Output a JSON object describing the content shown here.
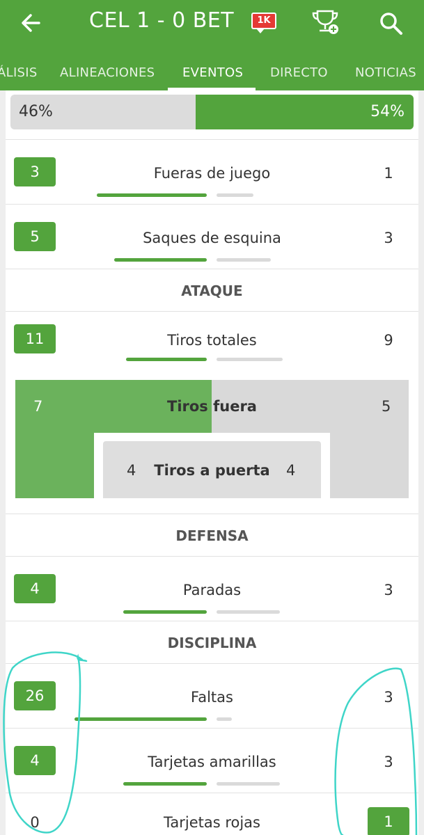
{
  "header": {
    "title": "CEL 1 - 0 BET",
    "badge": "1K"
  },
  "tabs": [
    {
      "label": "ÁLISIS"
    },
    {
      "label": "ALINEACIONES"
    },
    {
      "label": "EVENTOS"
    },
    {
      "label": "DIRECTO"
    },
    {
      "label": "NOTICIAS"
    }
  ],
  "active_tab": "EVENTOS",
  "possession": {
    "home": "46%",
    "away": "54%",
    "home_value": 46,
    "away_value": 54
  },
  "stats": {
    "offsides": {
      "home": "3",
      "label": "Fueras de juego",
      "away": "1"
    },
    "corners": {
      "home": "5",
      "label": "Saques de esquina",
      "away": "3"
    },
    "total_shots": {
      "home": "11",
      "label": "Tiros totales",
      "away": "9"
    },
    "shots_off": {
      "home": "7",
      "label": "Tiros fuera",
      "away": "5"
    },
    "shots_on": {
      "home": "4",
      "label": "Tiros a puerta",
      "away": "4"
    },
    "saves": {
      "home": "4",
      "label": "Paradas",
      "away": "3"
    },
    "fouls": {
      "home": "26",
      "label": "Faltas",
      "away": "3"
    },
    "yellow_cards": {
      "home": "4",
      "label": "Tarjetas amarillas",
      "away": "3"
    },
    "red_cards": {
      "home": "0",
      "label": "Tarjetas rojas",
      "away": "1"
    }
  },
  "sections": {
    "attack": "ATAQUE",
    "defense": "DEFENSA",
    "discipline": "DISCIPLINA"
  },
  "colors": {
    "brand_green": "#53a43d",
    "light_green": "#6bb25c",
    "bar_grey": "#dadada",
    "annotation": "#3fd5c8"
  }
}
